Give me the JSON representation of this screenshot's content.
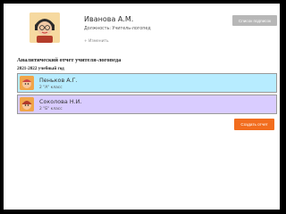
{
  "user": {
    "name": "Иванова А.М.",
    "position": "Должность: Учитель-логопед",
    "change_link": "+ Изменить"
  },
  "header": {
    "students_button": "Список подписок"
  },
  "report": {
    "title": "Аналитический отчет учителя-логопеда",
    "year": "2021-2022 учебный год"
  },
  "students": [
    {
      "name": "Пеньков А.Г.",
      "class": "2 \"А\" класс",
      "color": "#b7ecff"
    },
    {
      "name": "Соколова Н.И.",
      "class": "2 \"Б\" класс",
      "color": "#d9ccff"
    }
  ],
  "actions": {
    "send_button": "Создать отчет",
    "accent": "#f26d1e"
  }
}
